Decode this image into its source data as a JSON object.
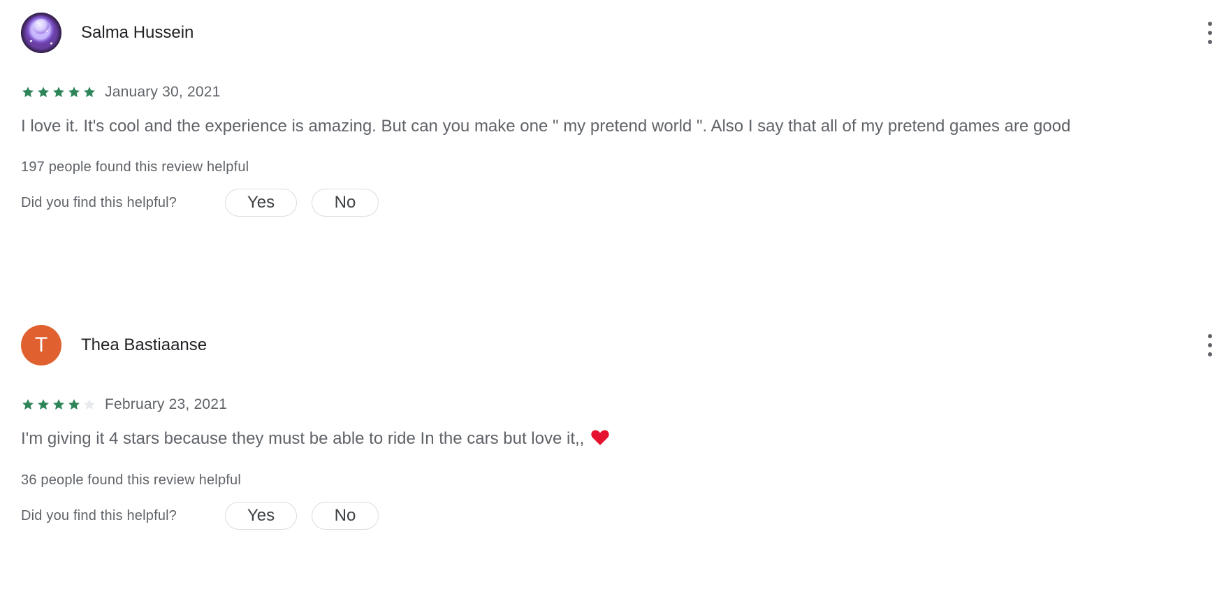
{
  "reviews": [
    {
      "name": "Salma Hussein",
      "avatar": {
        "type": "image",
        "description": "purple space avatar"
      },
      "rating": 5,
      "date": "January 30, 2021",
      "text": "I love it. It's cool and the experience is amazing. But can you make one \" my pretend world \". Also I say that all of my pretend games are good",
      "helpful_count": "197 people found this review helpful",
      "helpful_question": "Did you find this helpful?",
      "yes_label": "Yes",
      "no_label": "No",
      "more_icon": "more-vertical-icon"
    },
    {
      "name": "Thea Bastiaanse",
      "avatar": {
        "type": "letter",
        "letter": "T",
        "color": "#e0612f"
      },
      "rating": 4,
      "date": "February 23, 2021",
      "text": "I'm giving it 4 stars because they must be able to ride In the cars but love it,,",
      "text_emoji": "red-heart-icon",
      "helpful_count": "36 people found this review helpful",
      "helpful_question": "Did you find this helpful?",
      "yes_label": "Yes",
      "no_label": "No",
      "more_icon": "more-vertical-icon"
    }
  ],
  "colors": {
    "star_filled": "#2f855a",
    "star_empty": "#e8eaed",
    "heart": "#e4112f",
    "avatar_letter_bg": "#e0612f"
  }
}
